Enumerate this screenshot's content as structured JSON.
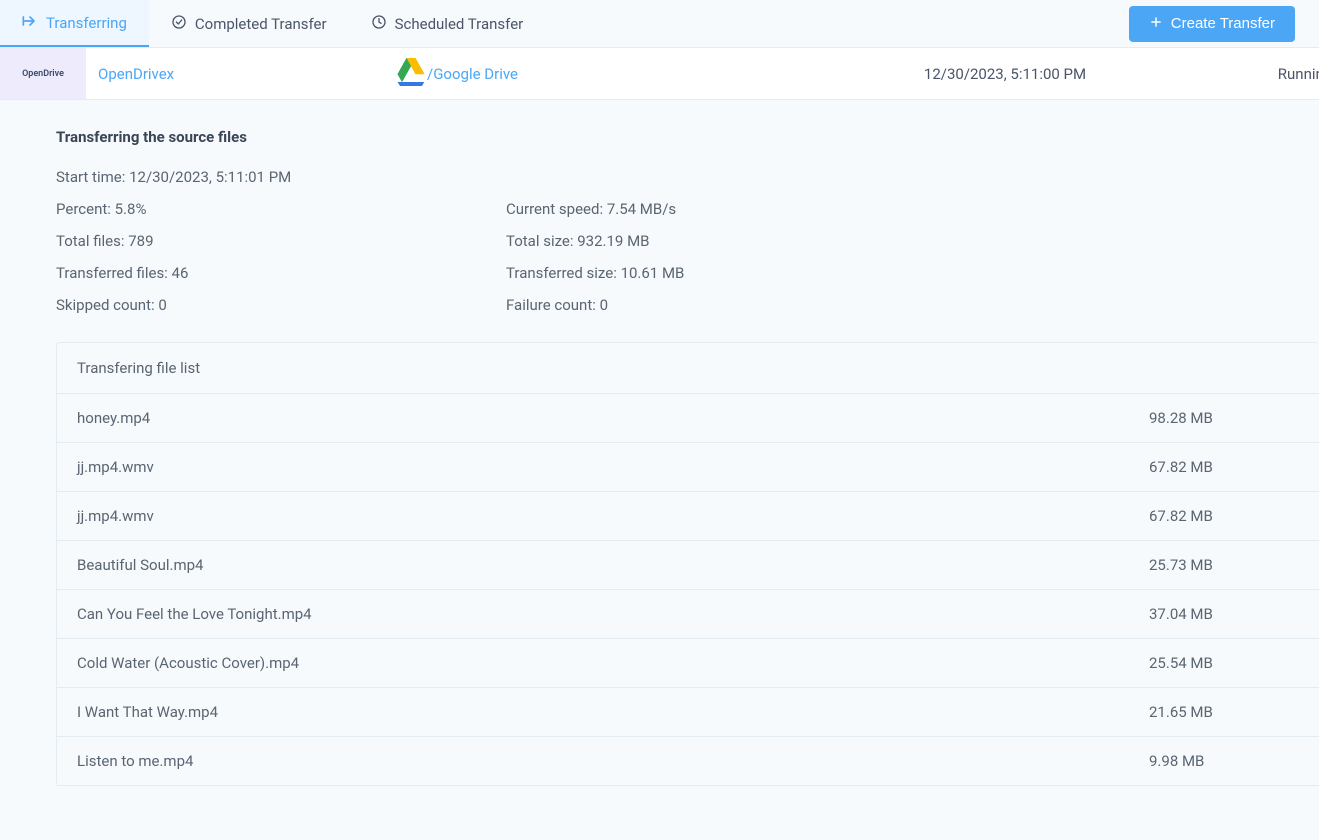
{
  "tabs": {
    "transferring": "Transferring",
    "completed": "Completed Transfer",
    "scheduled": "Scheduled Transfer"
  },
  "create_button": "Create Transfer",
  "transfer": {
    "source_logo_text": "OpenDrive",
    "source": "OpenDrivex",
    "destination": "/Google Drive",
    "timestamp": "12/30/2023, 5:11:00 PM",
    "status": "Running"
  },
  "details": {
    "heading": "Transferring the source files",
    "start_time_label": "Start time: ",
    "start_time": "12/30/2023, 5:11:01 PM",
    "percent_label": "Percent: ",
    "percent": "5.8%",
    "speed_label": "Current speed: ",
    "speed": "7.54 MB/s",
    "total_files_label": "Total files: ",
    "total_files": "789",
    "total_size_label": "Total size: ",
    "total_size": "932.19 MB",
    "transferred_files_label": "Transferred files: ",
    "transferred_files": "46",
    "transferred_size_label": "Transferred size: ",
    "transferred_size": "10.61 MB",
    "skipped_label": "Skipped count: ",
    "skipped": "0",
    "failure_label": "Failure count: ",
    "failure": "0"
  },
  "filelist": {
    "header": "Transfering file list",
    "files": [
      {
        "name": "honey.mp4",
        "size": "98.28 MB"
      },
      {
        "name": "jj.mp4.wmv",
        "size": "67.82 MB"
      },
      {
        "name": "jj.mp4.wmv",
        "size": "67.82 MB"
      },
      {
        "name": "Beautiful Soul.mp4",
        "size": "25.73 MB"
      },
      {
        "name": "Can You Feel the Love Tonight.mp4",
        "size": "37.04 MB"
      },
      {
        "name": "Cold Water (Acoustic Cover).mp4",
        "size": "25.54 MB"
      },
      {
        "name": "I Want That Way.mp4",
        "size": "21.65 MB"
      },
      {
        "name": "Listen to me.mp4",
        "size": "9.98 MB"
      }
    ]
  }
}
